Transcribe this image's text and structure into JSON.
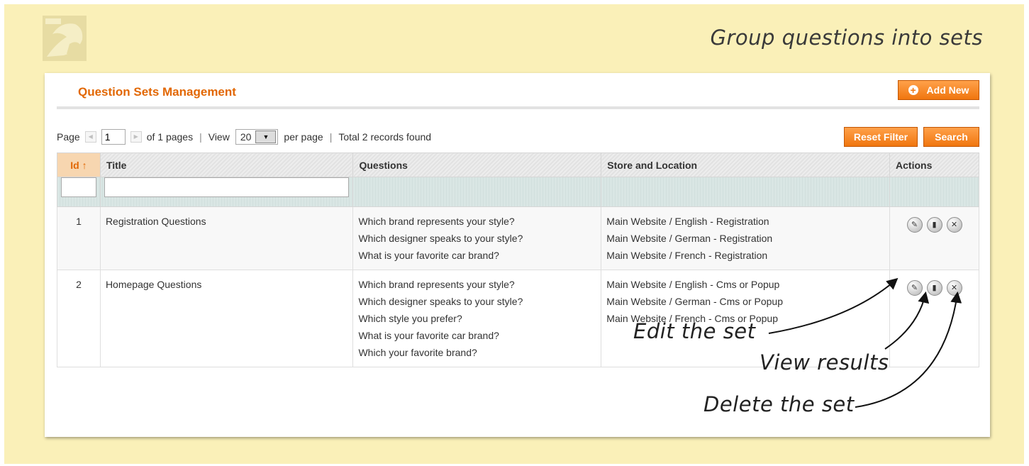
{
  "tagline": "Group questions into sets",
  "panel": {
    "title": "Question Sets Management",
    "add_button": "Add New"
  },
  "pager": {
    "page_label": "Page",
    "page_value": "1",
    "of_pages": "of 1 pages",
    "view_label": "View",
    "per_page_value": "20",
    "per_page_label": "per page",
    "total": "Total 2 records found",
    "reset_button": "Reset Filter",
    "search_button": "Search"
  },
  "grid": {
    "columns": [
      "Id",
      "Title",
      "Questions",
      "Store and Location",
      "Actions"
    ],
    "rows": [
      {
        "id": "1",
        "title": "Registration Questions",
        "questions": [
          "Which brand represents your style?",
          "Which designer speaks to your style?",
          "What is your favorite car brand?"
        ],
        "stores": [
          "Main Website / English - Registration",
          "Main Website / German - Registration",
          "Main Website / French - Registration"
        ]
      },
      {
        "id": "2",
        "title": "Homepage Questions",
        "questions": [
          "Which brand represents your style?",
          "Which designer speaks to your style?",
          "Which style you prefer?",
          "What is your favorite car brand?",
          "Which your favorite brand?"
        ],
        "stores": [
          "Main Website / English - Cms or Popup",
          "Main Website / German - Cms or Popup",
          "Main Website / French - Cms or Popup"
        ]
      }
    ]
  },
  "annotations": {
    "edit": "Edit the set",
    "view": "View results",
    "delete": "Delete the set"
  }
}
